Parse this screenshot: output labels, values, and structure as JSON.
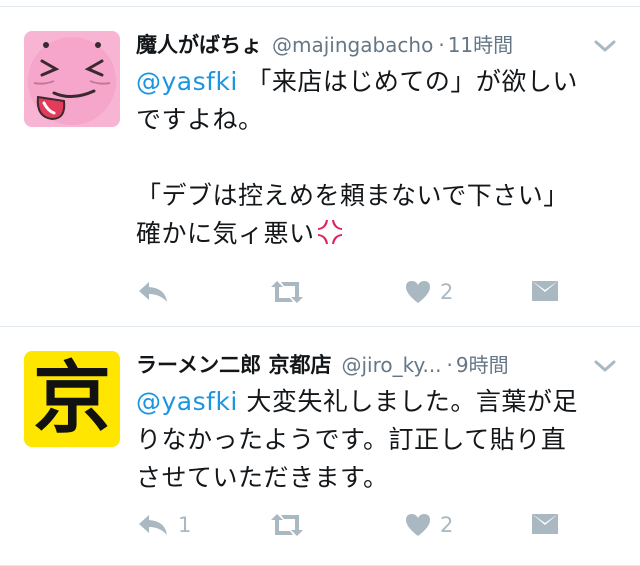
{
  "tweets": [
    {
      "name": "魔人がばちょ",
      "handle": "@majingabacho",
      "separator": "·",
      "time": "11時間",
      "mention": "@yasfki",
      "line1_rest": " 「来店はじめての」が欲しい",
      "line2": "ですよね。",
      "line3": "「デブは控えめを頼まないで下さい」",
      "line4": "確かに気ィ悪い",
      "emoji_icon": "anger-symbol-icon",
      "reply_count": "",
      "retweet_count": "",
      "like_count": "2"
    },
    {
      "name": "ラーメン二郎 京都店",
      "handle": "@jiro_ky...",
      "separator": "·",
      "time": "9時間",
      "avatar_text": "京",
      "mention": "@yasfki",
      "line1_rest": " 大変失礼しました。言葉が足",
      "line2": "りなかったようです。訂正して貼り直",
      "line3": "させていただきます。",
      "reply_count": "1",
      "retweet_count": "",
      "like_count": "2"
    }
  ],
  "colors": {
    "mention": "#1b95e0",
    "icon_gray": "#aab8c2",
    "divider": "#e1e8ed",
    "avatar2_bg": "#ffe600"
  }
}
